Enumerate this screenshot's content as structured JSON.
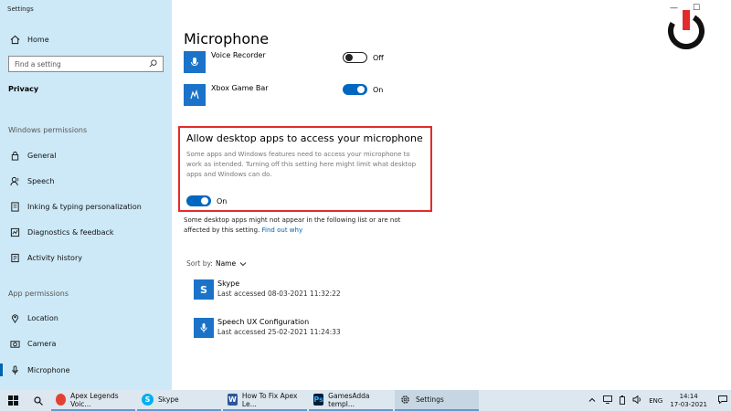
{
  "window": {
    "title": "Settings",
    "minimize": "—",
    "maximize": "☐",
    "close": "✕"
  },
  "sidebar": {
    "home": "Home",
    "search_placeholder": "Find a setting",
    "category": "Privacy",
    "windows_permissions_heading": "Windows permissions",
    "windows_permissions": [
      {
        "label": "General",
        "icon": "lock-icon"
      },
      {
        "label": "Speech",
        "icon": "speech-icon"
      },
      {
        "label": "Inking & typing personalization",
        "icon": "inking-icon"
      },
      {
        "label": "Diagnostics & feedback",
        "icon": "diagnostics-icon"
      },
      {
        "label": "Activity history",
        "icon": "activity-icon"
      }
    ],
    "app_permissions_heading": "App permissions",
    "app_permissions": [
      {
        "label": "Location",
        "icon": "location-icon"
      },
      {
        "label": "Camera",
        "icon": "camera-icon"
      },
      {
        "label": "Microphone",
        "icon": "microphone-icon",
        "active": true
      }
    ]
  },
  "main": {
    "title": "Microphone",
    "apps": [
      {
        "name": "Voice Recorder",
        "state": "Off",
        "on": false
      },
      {
        "name": "Xbox Game Bar",
        "state": "On",
        "on": true
      }
    ],
    "allow_desktop": {
      "title": "Allow desktop apps to access your microphone",
      "description": "Some apps and Windows features need to access your microphone to work as intended. Turning off this setting here might limit what desktop apps and Windows can do.",
      "state": "On"
    },
    "note_text": "Some desktop apps might not appear in the following list or are not affected by this setting.",
    "note_link": "Find out why",
    "sort_label": "Sort by:",
    "sort_value": "Name",
    "desktop_apps": [
      {
        "name": "Skype",
        "last": "Last accessed 08-03-2021 11:32:22"
      },
      {
        "name": "Speech UX Configuration",
        "last": "Last accessed 25-02-2021 11:24:33"
      }
    ]
  },
  "taskbar": {
    "apps": [
      {
        "label": "Apex Legends Voic...",
        "icon": "chrome-icon",
        "color": "#e34133"
      },
      {
        "label": "Skype",
        "icon": "skype-icon",
        "color": "#00aff0"
      },
      {
        "label": "How To Fix Apex Le...",
        "icon": "word-icon",
        "color": "#2b579a"
      },
      {
        "label": "GamesAdda templ...",
        "icon": "photoshop-icon",
        "color": "#001e36"
      },
      {
        "label": "Settings",
        "icon": "settings-gear-icon",
        "color": "#555555"
      }
    ],
    "language": "ENG",
    "time": "14:14",
    "date": "17-03-2021"
  },
  "colors": {
    "sidebar_bg": "#cde9f7",
    "accent": "#0067c0",
    "highlight_border": "#e32b2b",
    "logo_red": "#e32b2b"
  }
}
